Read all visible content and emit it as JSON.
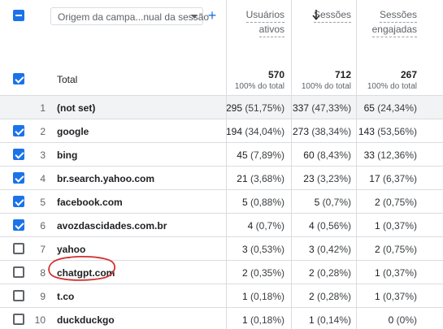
{
  "header": {
    "dimension_select_label": "Origem da campa...nual da sessão",
    "add_dimension_symbol": "+",
    "columns": [
      {
        "label_line1": "Usuários",
        "label_line2": "ativos"
      },
      {
        "label_line1": "Sessões",
        "label_line2": ""
      },
      {
        "label_line1": "Sessões",
        "label_line2": "engajadas"
      }
    ]
  },
  "totals": {
    "label": "Total",
    "values": [
      "570",
      "712",
      "267"
    ],
    "subs": [
      "100% do total",
      "100% do total",
      "100% do total"
    ]
  },
  "rows": [
    {
      "idx": "1",
      "name": "(not set)",
      "checkbox": "none",
      "v1": "295",
      "p1": "(51,75%)",
      "v2": "337",
      "p2": "(47,33%)",
      "v3": "65",
      "p3": "(24,34%)"
    },
    {
      "idx": "2",
      "name": "google",
      "checkbox": "checked",
      "v1": "194",
      "p1": "(34,04%)",
      "v2": "273",
      "p2": "(38,34%)",
      "v3": "143",
      "p3": "(53,56%)"
    },
    {
      "idx": "3",
      "name": "bing",
      "checkbox": "checked",
      "v1": "45",
      "p1": "(7,89%)",
      "v2": "60",
      "p2": "(8,43%)",
      "v3": "33",
      "p3": "(12,36%)"
    },
    {
      "idx": "4",
      "name": "br.search.yahoo.com",
      "checkbox": "checked",
      "v1": "21",
      "p1": "(3,68%)",
      "v2": "23",
      "p2": "(3,23%)",
      "v3": "17",
      "p3": "(6,37%)"
    },
    {
      "idx": "5",
      "name": "facebook.com",
      "checkbox": "checked",
      "v1": "5",
      "p1": "(0,88%)",
      "v2": "5",
      "p2": "(0,7%)",
      "v3": "2",
      "p3": "(0,75%)"
    },
    {
      "idx": "6",
      "name": "avozdascidades.com.br",
      "checkbox": "checked",
      "v1": "4",
      "p1": "(0,7%)",
      "v2": "4",
      "p2": "(0,56%)",
      "v3": "1",
      "p3": "(0,37%)"
    },
    {
      "idx": "7",
      "name": "yahoo",
      "checkbox": "unchecked",
      "v1": "3",
      "p1": "(0,53%)",
      "v2": "3",
      "p2": "(0,42%)",
      "v3": "2",
      "p3": "(0,75%)"
    },
    {
      "idx": "8",
      "name": "chatgpt.com",
      "checkbox": "unchecked",
      "v1": "2",
      "p1": "(0,35%)",
      "v2": "2",
      "p2": "(0,28%)",
      "v3": "1",
      "p3": "(0,37%)"
    },
    {
      "idx": "9",
      "name": "t.co",
      "checkbox": "unchecked",
      "v1": "1",
      "p1": "(0,18%)",
      "v2": "2",
      "p2": "(0,28%)",
      "v3": "1",
      "p3": "(0,37%)"
    },
    {
      "idx": "10",
      "name": "duckduckgo",
      "checkbox": "unchecked",
      "v1": "1",
      "p1": "(0,18%)",
      "v2": "1",
      "p2": "(0,14%)",
      "v3": "0",
      "p3": "(0%)"
    }
  ],
  "colors": {
    "accent": "#1a73e8",
    "annotation": "#d32f2f",
    "row_shade": "#f1f3f4"
  },
  "icons": {
    "sort": "arrow-down-icon",
    "dropdown": "caret-down-icon",
    "add": "plus-icon"
  }
}
